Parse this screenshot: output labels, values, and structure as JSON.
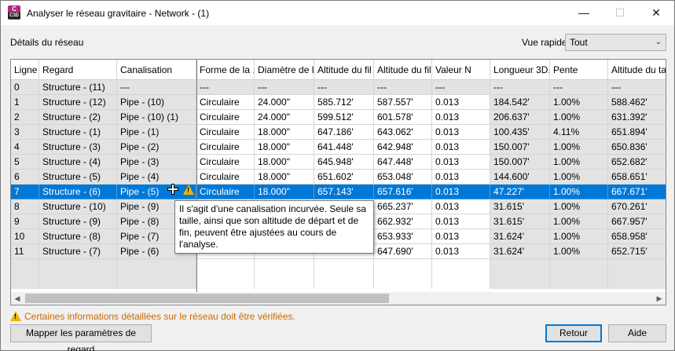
{
  "window": {
    "title": "Analyser le réseau gravitaire - Network - (1)",
    "app_icon_letter": "C",
    "app_icon_sub": "C3D",
    "minimize_label": "—",
    "maximize_label": "☐",
    "close_label": "✕"
  },
  "labels": {
    "details": "Détails du réseau",
    "vue_rapide": "Vue rapide"
  },
  "vue_rapide_select": {
    "value": "Tout"
  },
  "table": {
    "columns": [
      "Ligne",
      "Regard",
      "Canalisation",
      "Forme de la ...",
      "Diamètre de l...",
      "Altitude du fil ...",
      "Altitude du fil ...",
      "Valeur N",
      "Longueur 3D...",
      "Pente",
      "Altitude du ta..."
    ],
    "rows": [
      [
        "0",
        "Structure - (11)",
        "---",
        "---",
        "---",
        "---",
        "---",
        "---",
        "---",
        "---",
        "---"
      ],
      [
        "1",
        "Structure - (12)",
        "Pipe - (10)",
        "Circulaire",
        "24.000\"",
        "585.712'",
        "587.557'",
        "0.013",
        "184.542'",
        "1.00%",
        "588.462'"
      ],
      [
        "2",
        "Structure - (2)",
        "Pipe - (10) (1)",
        "Circulaire",
        "24.000\"",
        "599.512'",
        "601.578'",
        "0.013",
        "206.637'",
        "1.00%",
        "631.392'"
      ],
      [
        "3",
        "Structure - (1)",
        "Pipe - (1)",
        "Circulaire",
        "18.000\"",
        "647.186'",
        "643.062'",
        "0.013",
        "100.435'",
        "4.11%",
        "651.894'"
      ],
      [
        "4",
        "Structure - (3)",
        "Pipe - (2)",
        "Circulaire",
        "18.000\"",
        "641.448'",
        "642.948'",
        "0.013",
        "150.007'",
        "1.00%",
        "650.836'"
      ],
      [
        "5",
        "Structure - (4)",
        "Pipe - (3)",
        "Circulaire",
        "18.000\"",
        "645.948'",
        "647.448'",
        "0.013",
        "150.007'",
        "1.00%",
        "652.682'"
      ],
      [
        "6",
        "Structure - (5)",
        "Pipe - (4)",
        "Circulaire",
        "18.000\"",
        "651.602'",
        "653.048'",
        "0.013",
        "144.600'",
        "1.00%",
        "658.651'"
      ],
      [
        "7",
        "Structure - (6)",
        "Pipe - (5)",
        "Circulaire",
        "18.000\"",
        "657.143'",
        "657.616'",
        "0.013",
        "47.227'",
        "1.00%",
        "667.671'"
      ],
      [
        "8",
        "Structure - (10)",
        "Pipe - (9)",
        "",
        "",
        "",
        "665.237'",
        "0.013",
        "31.615'",
        "1.00%",
        "670.261'"
      ],
      [
        "9",
        "Structure - (9)",
        "Pipe - (8)",
        "",
        "",
        "",
        "662.932'",
        "0.013",
        "31.615'",
        "1.00%",
        "667.957'"
      ],
      [
        "10",
        "Structure - (8)",
        "Pipe - (7)",
        "",
        "",
        "",
        "653.933'",
        "0.013",
        "31.624'",
        "1.00%",
        "658.958'"
      ],
      [
        "11",
        "Structure - (7)",
        "Pipe - (6)",
        "",
        "",
        "",
        "647.690'",
        "0.013",
        "31.624'",
        "1.00%",
        "652.715'"
      ]
    ],
    "selected_row": 7
  },
  "tooltip": {
    "text": "Il s'agit d'une canalisation incurvée. Seule sa taille, ainsi que son altitude de départ et de fin, peuvent être ajustées au cours de l'analyse."
  },
  "footer": {
    "warning": "Certaines informations détaillées sur le réseau doit être vérifiées.",
    "map_button": "Mapper les paramètres de regard",
    "retour_button": "Retour",
    "aide_button": "Aide"
  },
  "colors": {
    "selection": "#0078d7",
    "warning_text": "#c86c00",
    "warning_icon": "#f0b400"
  },
  "icons": {
    "warning": "warning-triangle-icon",
    "cursor": "move-cursor-icon"
  }
}
